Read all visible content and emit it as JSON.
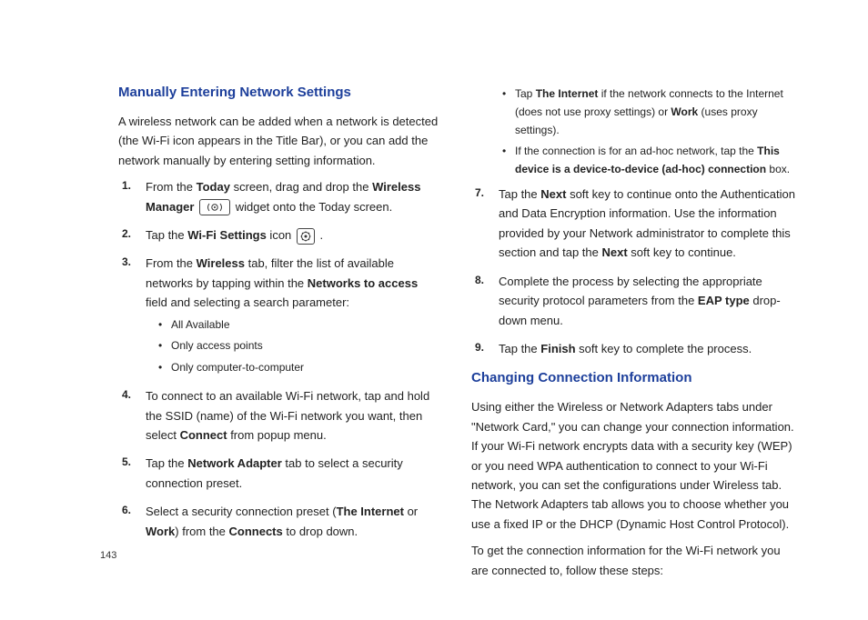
{
  "pageNumber": "143",
  "left": {
    "heading1": "Manually Entering Network Settings",
    "intro": "A wireless network can be added when a network is detected (the Wi-Fi icon appears in the Title Bar), or you can add the network manually by entering setting information.",
    "step1": {
      "num": "1",
      "a": "From the ",
      "b": "Today",
      "c": " screen, drag and drop the ",
      "d": "Wireless Manager",
      "e": " widget onto the Today screen."
    },
    "step2": {
      "num": "2",
      "a": "Tap the ",
      "b": "Wi-Fi Settings",
      "c": " icon ",
      "d": "."
    },
    "step3": {
      "num": "3",
      "a": "From the ",
      "b": "Wireless",
      "c": " tab, filter the list of available networks by tapping within the ",
      "d": "Networks to access",
      "e": " field and selecting a search parameter:",
      "bullets": [
        "All Available",
        "Only access points",
        "Only computer-to-computer"
      ]
    },
    "step4": {
      "num": "4",
      "a": "To connect to an available Wi-Fi network, tap and hold the SSID (name) of the Wi-Fi network you want, then select ",
      "b": "Connect",
      "c": " from popup menu."
    },
    "step5": {
      "num": "5",
      "a": "Tap the ",
      "b": "Network Adapter",
      "c": " tab to select a security connection preset."
    },
    "step6": {
      "num": "6",
      "a": "Select a security connection preset (",
      "b": "The Internet",
      "c": " or ",
      "d": "Work",
      "e": ") from the ",
      "f": "Connects",
      "g": " to drop down."
    }
  },
  "right": {
    "topBullets": [
      {
        "a": "Tap ",
        "b": "The Internet",
        "c": " if the network connects to the Internet (does not use proxy settings) or ",
        "d": "Work",
        "e": " (uses proxy settings)."
      },
      {
        "a": "If the connection is for an ad-hoc network, tap the ",
        "b": "This device is a device-to-device (ad-hoc) connection",
        "c": " box."
      }
    ],
    "step7": {
      "num": "7",
      "a": "Tap the ",
      "b": "Next",
      "c": " soft key to continue onto the Authentication and Data Encryption information. Use the information provided by your Network administrator to complete this section and tap the ",
      "d": "Next",
      "e": " soft key to continue."
    },
    "step8": {
      "num": "8",
      "a": "Complete the process by selecting the appropriate security protocol parameters from the ",
      "b": "EAP type",
      "c": " drop-down menu."
    },
    "step9": {
      "num": "9",
      "a": "Tap the ",
      "b": "Finish",
      "c": " soft key to complete the process."
    },
    "heading2": "Changing Connection Information",
    "para1": "Using either the Wireless or Network Adapters tabs under \"Network Card,\" you can change your connection information. If your Wi-Fi network encrypts data with a security key (WEP) or you need WPA authentication to connect to your Wi-Fi network, you can set the configurations under Wireless tab. The Network Adapters tab allows you to choose whether you use a fixed IP or the DHCP (Dynamic Host Control Protocol).",
    "para2": "To get the connection information for the Wi-Fi network you are connected to, follow these steps:"
  }
}
